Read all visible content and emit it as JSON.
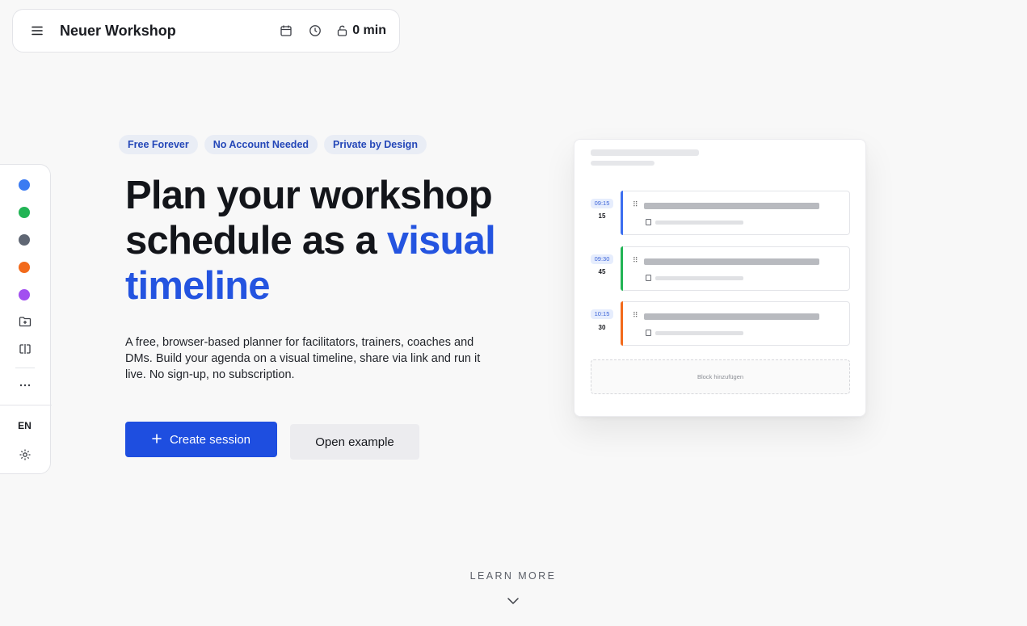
{
  "header": {
    "title": "Neuer Workshop",
    "duration": "0 min",
    "icons": [
      "menu-icon",
      "calendar-icon",
      "clock-icon",
      "lock-icon"
    ]
  },
  "sidebar": {
    "colors": [
      "#3b7bf2",
      "#22b455",
      "#5f6673",
      "#f26a1b",
      "#a24ff0"
    ],
    "icons": [
      "folder-plus-icon",
      "split-view-icon",
      "more-icon",
      "gear-icon"
    ],
    "language": "EN"
  },
  "hero": {
    "badges": [
      "Free Forever",
      "No Account Needed",
      "Private by Design"
    ],
    "headline_part1": "Plan your workshop schedule as a",
    "headline_accent": "visual timeline",
    "description": "A free, browser-based planner for facilitators, trainers, coaches and DMs. Build your agenda on a visual timeline, share via link and run it live. No sign-up, no subscription.",
    "primary_button": "Create session",
    "secondary_button": "Open example"
  },
  "preview": {
    "blocks": [
      {
        "time": "09:15",
        "duration": "15",
        "color": "#3b6ef0"
      },
      {
        "time": "09:30",
        "duration": "45",
        "color": "#22b455"
      },
      {
        "time": "10:15",
        "duration": "30",
        "color": "#f26a1b"
      }
    ],
    "add_block_label": "Block hinzufügen"
  },
  "footer": {
    "learn_more": "LEARN MORE"
  }
}
